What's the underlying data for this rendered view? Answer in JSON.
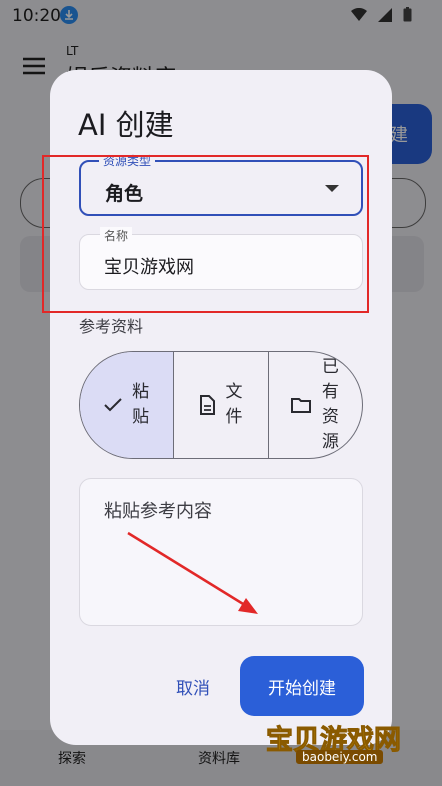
{
  "status_bar": {
    "time": "10:20"
  },
  "background": {
    "app_subtitle": "LT",
    "app_title": "娱乐资料库",
    "create_button": "建",
    "nav": {
      "explore": "探索",
      "library": "资料库"
    }
  },
  "dialog": {
    "title": "AI 创建",
    "type_field": {
      "label": "资源类型",
      "value": "角色"
    },
    "name_field": {
      "label": "名称",
      "value": "宝贝游戏网"
    },
    "reference_label": "参考资料",
    "segments": [
      {
        "label": "粘贴",
        "icon": "check-icon",
        "selected": true
      },
      {
        "label": "文件",
        "icon": "document-icon",
        "selected": false
      },
      {
        "label": "已有资源",
        "icon": "folder-icon",
        "selected": false
      }
    ],
    "paste_placeholder": "粘贴参考内容",
    "cancel_label": "取消",
    "start_label": "开始创建"
  },
  "watermark": {
    "text": "宝贝游戏网",
    "url": "baobeiy.com"
  },
  "colors": {
    "accent": "#2b5fd8",
    "annotation": "#e22828",
    "selected_segment": "#dbdcf5"
  }
}
